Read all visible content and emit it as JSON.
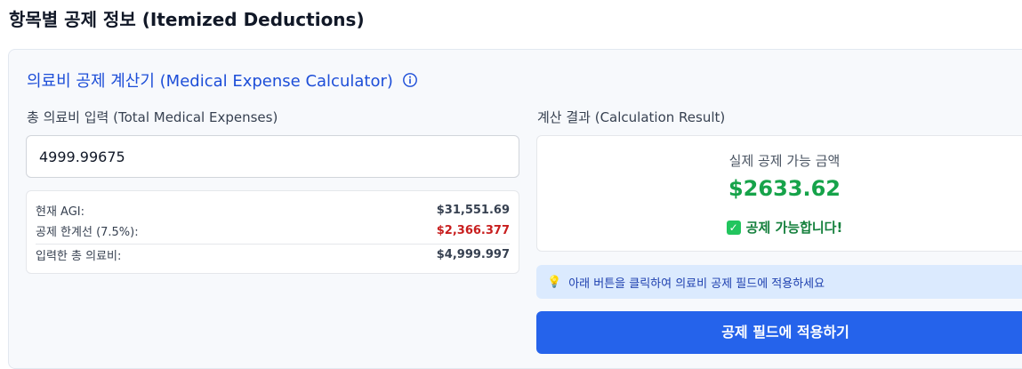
{
  "page": {
    "title": "항목별 공제 정보 (Itemized Deductions)"
  },
  "calculator": {
    "title": "의료비 공제 계산기 (Medical Expense Calculator)",
    "info_icon": "info-circle-icon",
    "input_label": "총 의료비 입력 (Total Medical Expenses)",
    "input_value": "4999.99675",
    "summary": {
      "agi_label": "현재 AGI:",
      "agi_value": "$31,551.69",
      "threshold_label": "공제 한계선 (7.5%):",
      "threshold_value": "$2,366.377",
      "entered_label": "입력한 총 의료비:",
      "entered_value": "$4,999.997"
    },
    "result_label": "계산 결과 (Calculation Result)",
    "result": {
      "caption": "실제 공제 가능 금액",
      "amount": "$2633.62",
      "status": "공제 가능합니다!",
      "status_icon": "check-box-icon"
    },
    "hint": {
      "icon": "lightbulb-icon",
      "text": "아래 버튼을 클릭하여 의료비 공제 필드에 적용하세요"
    },
    "apply_button": "공제 필드에 적용하기"
  },
  "colors": {
    "accent": "#2563eb",
    "success": "#16a34a",
    "warning": "#c81e1e",
    "title_blue": "#1d4ed8"
  }
}
